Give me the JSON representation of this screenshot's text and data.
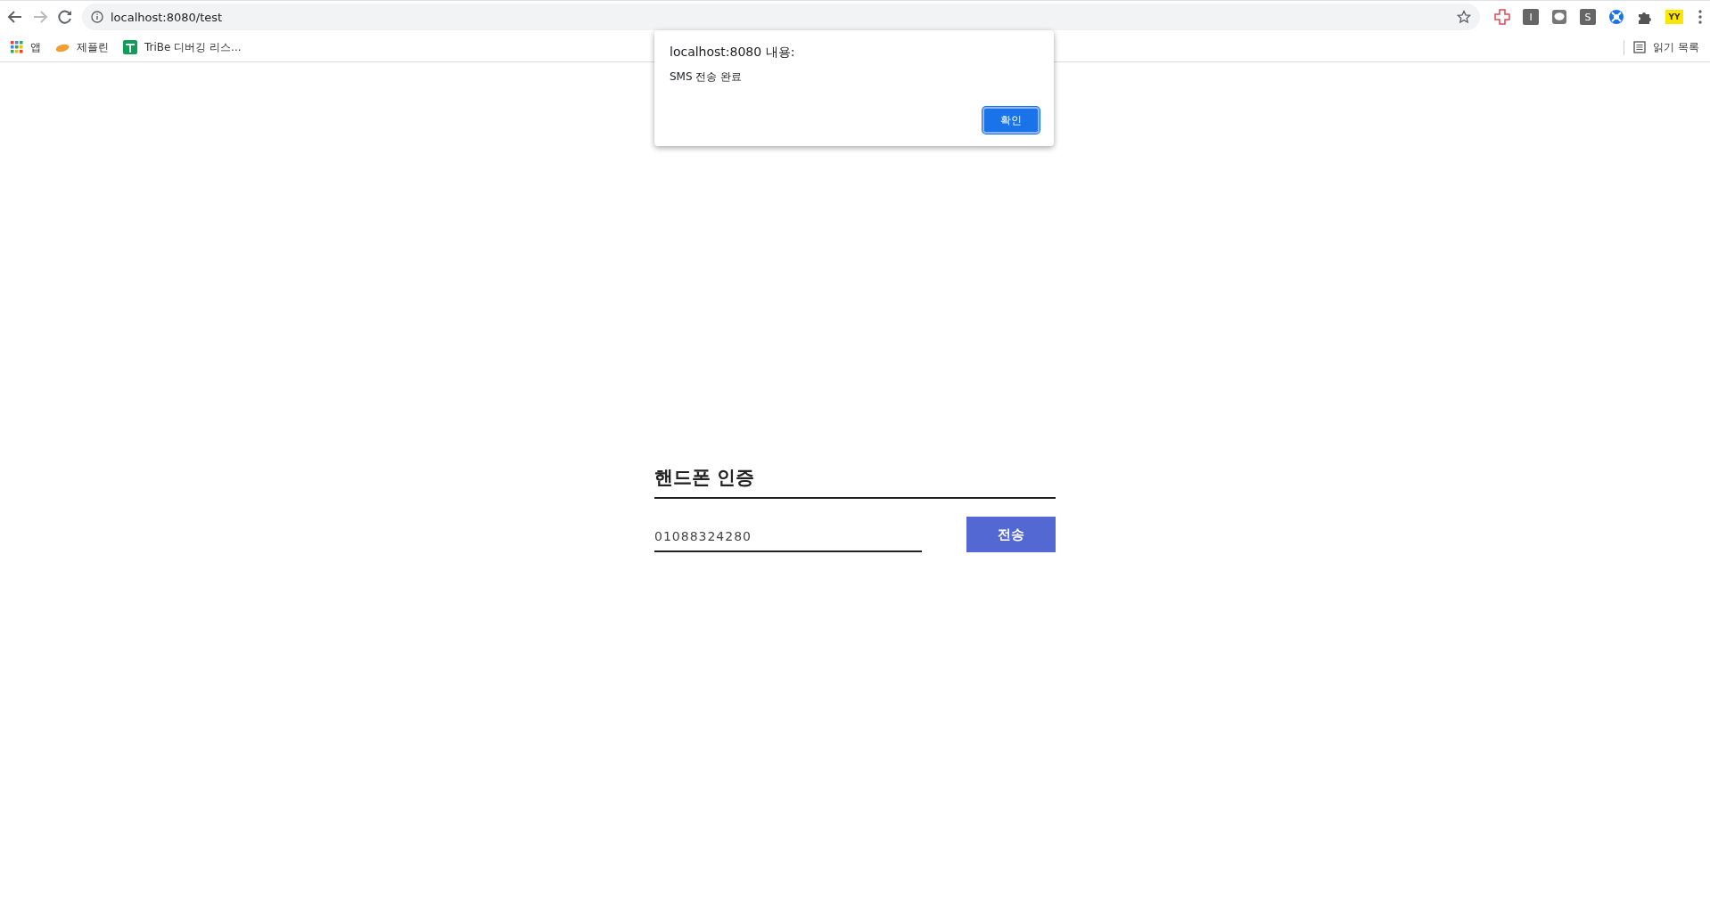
{
  "browser": {
    "url": "localhost:8080/test",
    "extensions": [
      {
        "kind": "cross"
      },
      {
        "kind": "letter",
        "label": "I"
      },
      {
        "kind": "chat"
      },
      {
        "kind": "letter",
        "label": "S"
      },
      {
        "kind": "ball"
      },
      {
        "kind": "puzzle"
      },
      {
        "kind": "yellow",
        "label": "YY"
      }
    ],
    "bookmarks": [
      {
        "kind": "apps",
        "label": "앱"
      },
      {
        "kind": "bread",
        "label": "제플린"
      },
      {
        "kind": "sheet",
        "label": "TriBe 디버깅 리스..."
      }
    ],
    "reading_list": "읽기 목록"
  },
  "dialog": {
    "title": "localhost:8080 내용:",
    "message": "SMS 전송 완료",
    "button": "확인"
  },
  "form": {
    "title": "핸드폰 인증",
    "phone": "01088324280",
    "button": "전송"
  }
}
